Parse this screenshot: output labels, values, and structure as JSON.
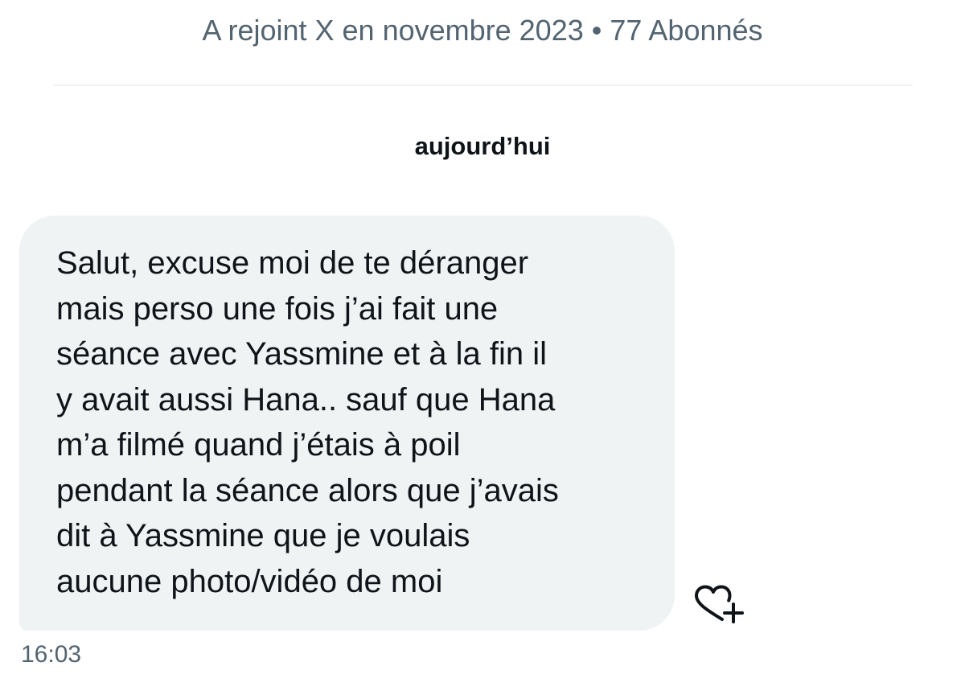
{
  "profile": {
    "meta": "A rejoint X en novembre 2023 • 77 Abonnés"
  },
  "conversation": {
    "date_separator": "aujourd’hui",
    "messages": [
      {
        "text": "Salut, excuse moi de te déranger\nmais perso une fois j’ai fait une\nséance avec Yassmine et à la fin il\ny avait aussi Hana.. sauf que Hana\nm’a filmé quand j’étais à poil\npendant la séance alors que j’avais\ndit à Yassmine que je voulais\naucune photo/vidéo de moi",
        "time": "16:03",
        "reaction_icon": "heart-plus-icon"
      }
    ]
  },
  "colors": {
    "bubble_bg": "#eff3f4",
    "secondary_text": "#536471",
    "primary_text": "#0f1419"
  }
}
